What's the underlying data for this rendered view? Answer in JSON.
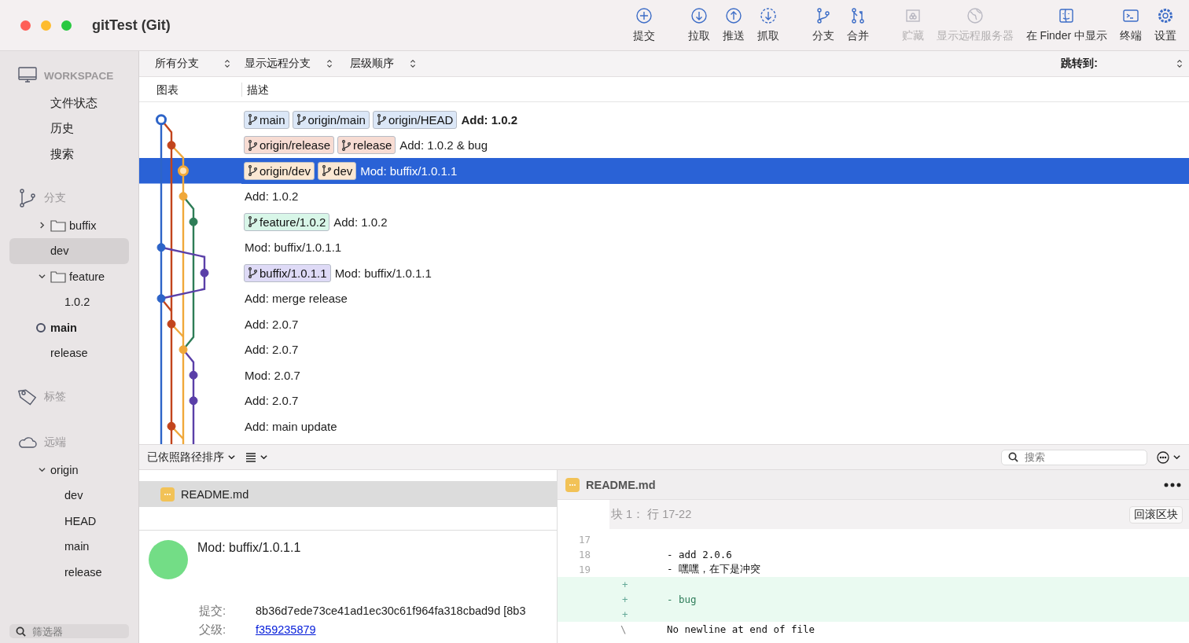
{
  "window": {
    "title": "gitTest (Git)"
  },
  "toolbar": {
    "groups": [
      {
        "buttons": [
          {
            "kind": "commit",
            "label": "提交",
            "disabled": false
          }
        ]
      },
      {
        "buttons": [
          {
            "kind": "pull",
            "label": "拉取",
            "disabled": false
          },
          {
            "kind": "push",
            "label": "推送",
            "disabled": false
          },
          {
            "kind": "fetch",
            "label": "抓取",
            "disabled": false
          }
        ]
      },
      {
        "buttons": [
          {
            "kind": "branch",
            "label": "分支",
            "disabled": false
          },
          {
            "kind": "merge",
            "label": "合并",
            "disabled": false
          }
        ]
      },
      {
        "buttons": [
          {
            "kind": "stash",
            "label": "贮藏",
            "disabled": true
          },
          {
            "kind": "remote",
            "label": "显示远程服务器",
            "disabled": true
          },
          {
            "kind": "finder",
            "label": "在 Finder 中显示",
            "disabled": false
          },
          {
            "kind": "terminal",
            "label": "终端",
            "disabled": false
          },
          {
            "kind": "settings",
            "label": "设置",
            "disabled": false
          }
        ]
      }
    ]
  },
  "sidebar": {
    "sections": [
      {
        "kind": "workspace",
        "title": "WORKSPACE",
        "items": [
          {
            "label": "文件状态",
            "selected": false
          },
          {
            "label": "历史",
            "selected": false
          },
          {
            "label": "搜索",
            "selected": false
          }
        ]
      },
      {
        "kind": "branches",
        "title": "分支",
        "items": [
          {
            "kind": "folder",
            "label": "buffix",
            "expanded": false,
            "selected": false,
            "current": false
          },
          {
            "kind": "branch",
            "label": "dev",
            "selected": true,
            "current": false
          },
          {
            "kind": "folder",
            "label": "feature",
            "expanded": true,
            "selected": false,
            "current": false,
            "children": [
              {
                "label": "1.0.2",
                "selected": false,
                "current": false
              }
            ]
          },
          {
            "kind": "branch",
            "label": "main",
            "selected": false,
            "current": true
          },
          {
            "kind": "branch",
            "label": "release",
            "selected": false,
            "current": false
          }
        ]
      },
      {
        "kind": "tags",
        "title": "标签"
      },
      {
        "kind": "remotes",
        "title": "远端",
        "items": [
          {
            "label": "origin",
            "expanded": true,
            "selected": false,
            "children": [
              {
                "label": "dev",
                "selected": false
              },
              {
                "label": "HEAD",
                "selected": false
              },
              {
                "label": "main",
                "selected": false
              },
              {
                "label": "release",
                "selected": false
              }
            ]
          }
        ]
      }
    ],
    "filter": {
      "placeholder": "筛选器"
    }
  },
  "filter_bar": {
    "dropdowns": [
      {
        "label": "所有分支"
      },
      {
        "label": "显示远程分支"
      },
      {
        "label": "层级顺序"
      }
    ],
    "jump": {
      "label": "跳转到:"
    }
  },
  "columns": [
    "图表",
    "描述"
  ],
  "commits": [
    {
      "message": "Add: 1.0.2",
      "current": true,
      "selected": false,
      "refs": [
        {
          "name": "main",
          "color": "#dbe7f7"
        },
        {
          "name": "origin/main",
          "color": "#dbe7f7"
        },
        {
          "name": "origin/HEAD",
          "color": "#dbe7f7"
        }
      ]
    },
    {
      "message": "Add: 1.0.2 & bug",
      "current": false,
      "selected": false,
      "refs": [
        {
          "name": "origin/release",
          "color": "#f7dcd3"
        },
        {
          "name": "release",
          "color": "#f7dcd3"
        }
      ]
    },
    {
      "message": "Mod: buffix/1.0.1.1",
      "current": false,
      "selected": true,
      "refs": [
        {
          "name": "origin/dev",
          "color": "#fbe8d3"
        },
        {
          "name": "dev",
          "color": "#fbe8d3"
        }
      ]
    },
    {
      "message": "Add: 1.0.2",
      "current": false,
      "selected": false
    },
    {
      "message": "Add: 1.0.2",
      "current": false,
      "selected": false,
      "refs": [
        {
          "name": "feature/1.0.2",
          "color": "#d8f6e8"
        }
      ]
    },
    {
      "message": "Mod: buffix/1.0.1.1",
      "current": false,
      "selected": false
    },
    {
      "message": "Mod: buffix/1.0.1.1",
      "current": false,
      "selected": false,
      "refs": [
        {
          "name": "buffix/1.0.1.1",
          "color": "#dedaf6"
        }
      ]
    },
    {
      "message": "Add: merge release",
      "current": false,
      "selected": false
    },
    {
      "message": "Add: 2.0.7",
      "current": false,
      "selected": false
    },
    {
      "message": "Add: 2.0.7",
      "current": false,
      "selected": false
    },
    {
      "message": "Mod: 2.0.7",
      "current": false,
      "selected": false
    },
    {
      "message": "Add: 2.0.7",
      "current": false,
      "selected": false
    },
    {
      "message": "Add: main update",
      "current": false,
      "selected": false
    }
  ],
  "bottom_bar": {
    "sort": "已依照路径排序",
    "search": {
      "placeholder": "搜索"
    }
  },
  "files": [
    {
      "name": "README.md",
      "selected": true
    }
  ],
  "details": {
    "message": "Mod: buffix/1.0.1.1",
    "fields": [
      {
        "kind": "text",
        "label": "提交:",
        "value": "8b36d7ede73ce41ad1ec30c61f964fa318cbad9d [8b3"
      },
      {
        "kind": "link",
        "label": "父级:",
        "value": "f359235879"
      }
    ]
  },
  "diff": {
    "file": "README.md",
    "hunk": {
      "title": "块 1：  行 17-22",
      "button": "回滚区块"
    },
    "lines": [
      {
        "kind": "context",
        "number": "17"
      },
      {
        "kind": "context",
        "number": "18",
        "text": "- add 2.0.6"
      },
      {
        "kind": "context",
        "number": "19",
        "text": "- 嘿嘿，在下是冲突"
      },
      {
        "kind": "added",
        "marker": "+"
      },
      {
        "kind": "added",
        "marker": "+",
        "text": "- bug"
      },
      {
        "kind": "added",
        "marker": "+"
      },
      {
        "kind": "note",
        "marker": "\\",
        "text": "No newline at end of file"
      }
    ]
  }
}
